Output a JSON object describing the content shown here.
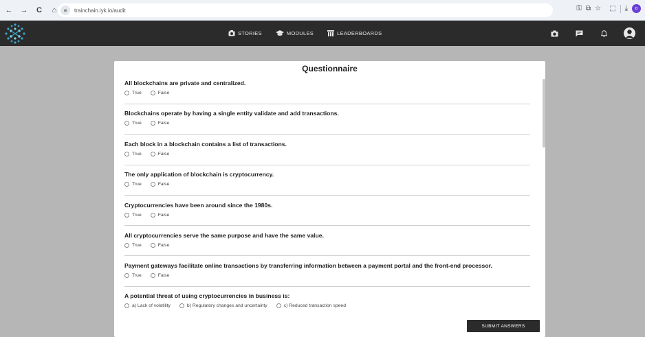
{
  "browser": {
    "url": "trainchain.iyk.io/audit",
    "nav_back": "←",
    "nav_forward": "→",
    "nav_reload": "C",
    "nav_home": "⌂",
    "profile_initial": "o"
  },
  "header": {
    "nav": [
      {
        "label": "STORIES"
      },
      {
        "label": "MODULES"
      },
      {
        "label": "LEADERBOARDS"
      }
    ]
  },
  "questionnaire": {
    "title": "Questionnaire",
    "questions": [
      {
        "text": "All blockchains are private and centralized.",
        "options": [
          "True",
          "False"
        ]
      },
      {
        "text": "Blockchains operate by having a single entity validate and add transactions.",
        "options": [
          "True",
          "False"
        ]
      },
      {
        "text": "Each block in a blockchain contains a list of transactions.",
        "options": [
          "True",
          "False"
        ]
      },
      {
        "text": "The only application of blockchain is cryptocurrency.",
        "options": [
          "True",
          "False"
        ]
      },
      {
        "text": "Cryptocurrencies have been around since the 1980s.",
        "options": [
          "True",
          "False"
        ]
      },
      {
        "text": "All cryptocurrencies serve the same purpose and have the same value.",
        "options": [
          "True",
          "False"
        ]
      },
      {
        "text": "Payment gateways facilitate online transactions by transferring information between a payment portal and the front-end processor.",
        "options": [
          "True",
          "False"
        ]
      },
      {
        "text": "A potential threat of using cryptocurrencies in business is:",
        "options": [
          "a) Lack of volatility",
          "b) Regulatory changes and uncertainty",
          "c) Reduced transaction speed"
        ]
      }
    ],
    "submit_label": "SUBMIT ANSWERS"
  }
}
